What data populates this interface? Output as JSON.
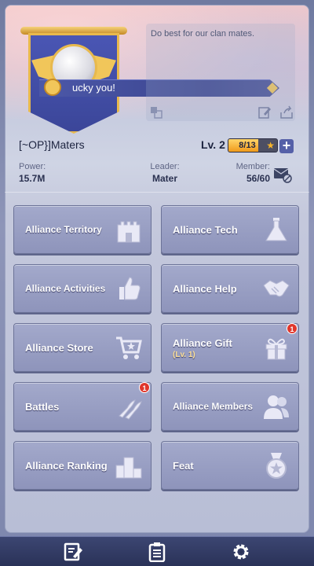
{
  "banner": {
    "lucky_text": "ucky you!"
  },
  "message": {
    "text": "Do best for our clan mates."
  },
  "profile": {
    "name": "[~OP}]Maters",
    "level_label": "Lv. 2",
    "exp_text": "8/13",
    "exp_fraction": 0.62
  },
  "stats": {
    "power_label": "Power:",
    "power_value": "15.7M",
    "leader_label": "Leader:",
    "leader_value": "Mater",
    "member_label": "Member:",
    "member_value": "56/60"
  },
  "tiles": [
    {
      "label": "Alliance Territory",
      "icon": "castle-icon"
    },
    {
      "label": "Alliance Tech",
      "icon": "flask-icon"
    },
    {
      "label": "Alliance Activities",
      "icon": "thumbs-up-icon"
    },
    {
      "label": "Alliance Help",
      "icon": "handshake-icon"
    },
    {
      "label": "Alliance Store",
      "icon": "cart-icon"
    },
    {
      "label": "Alliance Gift",
      "sublabel": "(Lv. 1)",
      "icon": "gift-icon",
      "badge": "1"
    },
    {
      "label": "Battles",
      "icon": "bullets-icon",
      "badge": "1"
    },
    {
      "label": "Alliance Members",
      "icon": "members-icon"
    },
    {
      "label": "Alliance Ranking",
      "icon": "podium-icon"
    },
    {
      "label": "Feat",
      "icon": "medal-icon"
    }
  ],
  "bottom_bar": {
    "icons": [
      "notepad-icon",
      "clipboard-icon",
      "gear-icon"
    ]
  },
  "colors": {
    "tile": "#9aa0c4",
    "badge": "#e0372c",
    "exp_fill": "#f09a1b"
  }
}
